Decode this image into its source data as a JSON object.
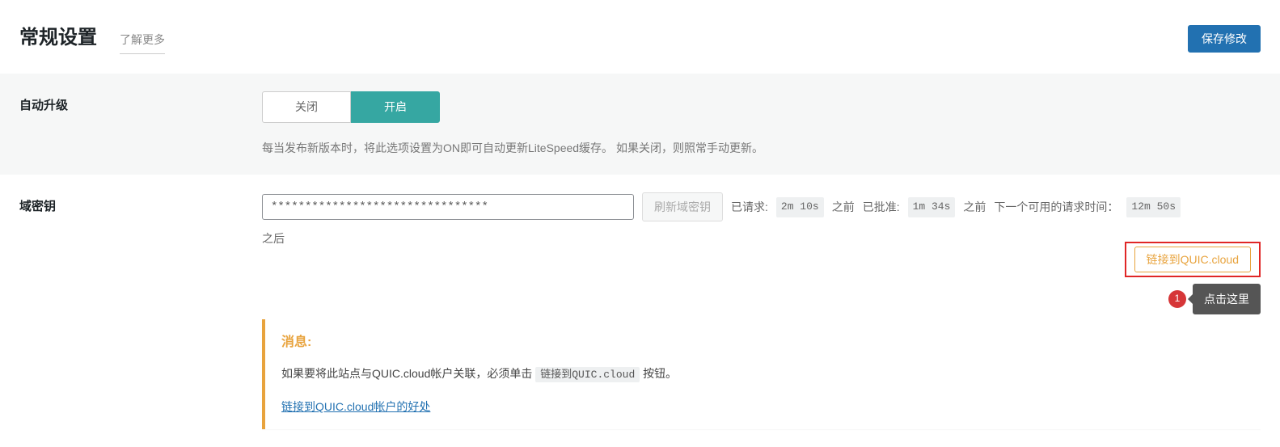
{
  "header": {
    "title": "常规设置",
    "learn_more": "了解更多",
    "save_btn": "保存修改"
  },
  "auto_upgrade": {
    "label": "自动升级",
    "off": "关闭",
    "on": "开启",
    "description": "每当发布新版本时，将此选项设置为ON即可自动更新LiteSpeed缓存。 如果关闭，则照常手动更新。"
  },
  "domain_key": {
    "label": "域密钥",
    "value": "********************************",
    "refresh_btn": "刷新域密钥",
    "requested_label": "已请求:",
    "requested_time": "2m 10s",
    "requested_suffix": "之前",
    "approved_label": "已批准:",
    "approved_time": "1m 34s",
    "approved_suffix": "之前",
    "next_label": "下一个可用的请求时间：",
    "next_time": "12m 50s",
    "next_suffix": "之后",
    "link_btn": "链接到QUIC.cloud"
  },
  "callout": {
    "step": "1",
    "tooltip": "点击这里"
  },
  "notice": {
    "title": "消息:",
    "text_before": "如果要将此站点与QUIC.cloud帐户关联，必须单击",
    "code": "链接到QUIC.cloud",
    "text_after": "按钮。",
    "benefits_link_text": "链接到QUIC.cloud帐户的好处"
  }
}
